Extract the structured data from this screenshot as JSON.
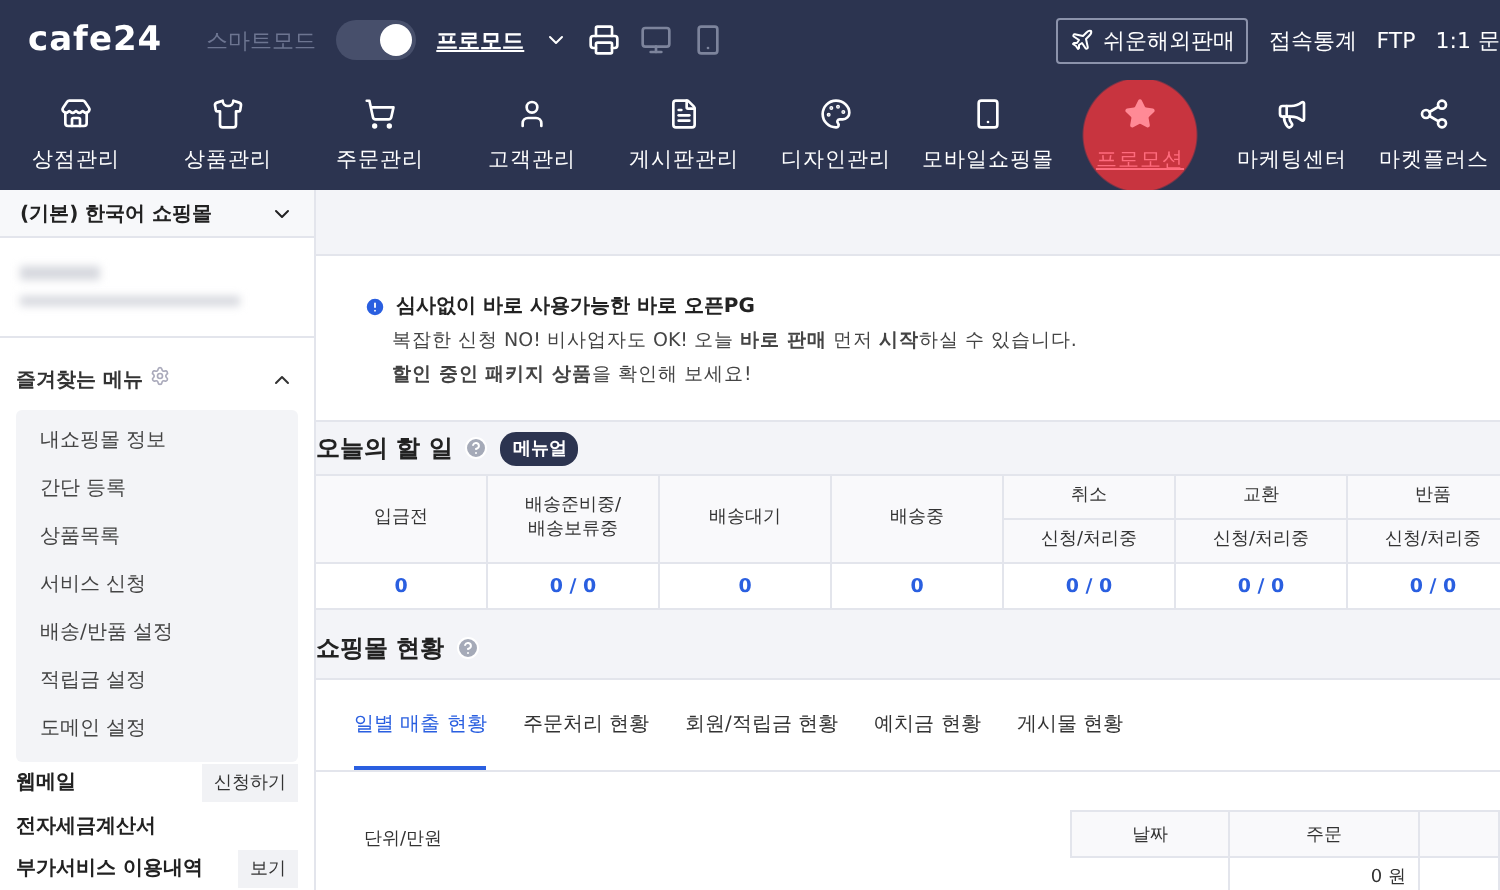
{
  "topbar": {
    "logo": "cafe24",
    "mode_label": "스마트모드",
    "pro_mode": true,
    "mode_value": "프로모드",
    "overseas_button": "쉬운해외판매",
    "links": [
      "접속통계",
      "FTP",
      "1:1 문"
    ]
  },
  "nav": [
    {
      "label": "상점관리",
      "selected": false
    },
    {
      "label": "상품관리",
      "selected": false
    },
    {
      "label": "주문관리",
      "selected": false
    },
    {
      "label": "고객관리",
      "selected": false
    },
    {
      "label": "게시판관리",
      "selected": false
    },
    {
      "label": "디자인관리",
      "selected": false
    },
    {
      "label": "모바일쇼핑몰",
      "selected": false
    },
    {
      "label": "프로모션",
      "selected": true
    },
    {
      "label": "마케팅센터",
      "selected": false
    },
    {
      "label": "마켓플러스",
      "selected": false
    }
  ],
  "sidebar": {
    "shop_select": "(기본) 한국어 쇼핑몰",
    "favorites": {
      "title": "즐겨찾는 메뉴",
      "expanded": true,
      "items": [
        "내쇼핑몰 정보",
        "간단 등록",
        "상품목록",
        "서비스 신청",
        "배송/반품 설정",
        "적립금 설정",
        "도메인 설정"
      ]
    },
    "links": [
      {
        "label": "웹메일",
        "button": "신청하기"
      },
      {
        "label": "전자세금계산서"
      },
      {
        "label": "부가서비스 이용내역",
        "button": "보기"
      }
    ]
  },
  "notice": {
    "title": "심사없이 바로 사용가능한 바로 오픈PG",
    "lines": [
      "복잡한 신청 NO! 비사업자도 OK! 오늘 **바로 판매** 먼저 **시작**하실 수 있습니다.",
      "**할인 중인 패키지 상품**을 확인해 보세요!"
    ]
  },
  "todo": {
    "title": "오늘의 할 일",
    "badge": "메뉴얼",
    "columns": [
      {
        "title": "입금전",
        "value": "0"
      },
      {
        "title": "배송준비중/\n배송보류중",
        "value": "0 / 0"
      },
      {
        "title": "배송대기",
        "value": "0"
      },
      {
        "title": "배송중",
        "value": "0"
      },
      {
        "title": "취소",
        "subtitle": "신청/처리중",
        "value": "0 / 0"
      },
      {
        "title": "교환",
        "subtitle": "신청/처리중",
        "value": "0 / 0"
      },
      {
        "title": "반품",
        "subtitle": "신청/처리중",
        "value": "0 / 0"
      }
    ]
  },
  "status": {
    "title": "쇼핑몰 현황",
    "tabs": [
      {
        "label": "일별 매출 현황",
        "selected": true
      },
      {
        "label": "주문처리 현황",
        "selected": false
      },
      {
        "label": "회원/적립금 현황",
        "selected": false
      },
      {
        "label": "예치금 현황",
        "selected": false
      },
      {
        "label": "게시물 현황",
        "selected": false
      }
    ],
    "unit": "단위/만원",
    "table": {
      "columns": [
        "날짜",
        "주문"
      ],
      "rows": [
        [
          "",
          "0 원"
        ]
      ]
    }
  }
}
